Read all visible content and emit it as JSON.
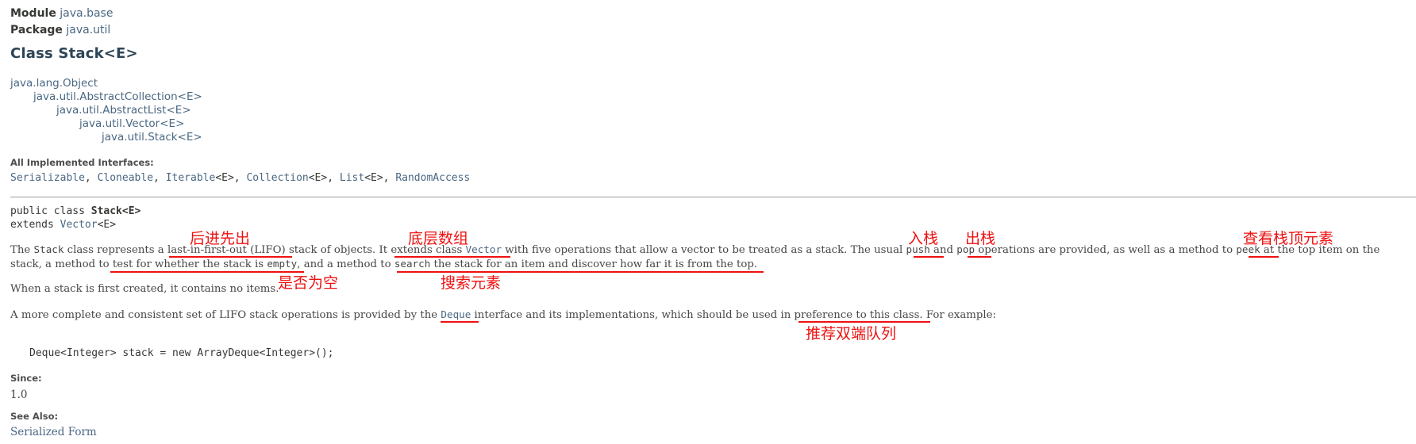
{
  "header": {
    "module_label": "Module",
    "module_value": "java.base",
    "package_label": "Package",
    "package_value": "java.util",
    "class_title": "Class Stack<E>"
  },
  "hierarchy": [
    "java.lang.Object",
    "java.util.AbstractCollection<E>",
    "java.util.AbstractList<E>",
    "java.util.Vector<E>",
    "java.util.Stack<E>"
  ],
  "interfaces": {
    "label": "All Implemented Interfaces:",
    "items": [
      "Serializable",
      "Cloneable",
      "Iterable",
      "Collection",
      "List",
      "RandomAccess"
    ],
    "generic": "<E>",
    "sep": ", "
  },
  "signature": {
    "line1_prefix": "public class ",
    "line1_name": "Stack<E>",
    "line2_prefix": "extends ",
    "line2_link": "Vector",
    "line2_suffix": "<E>"
  },
  "description": {
    "p1_l1": [
      {
        "text": "The ",
        "style": "t"
      },
      {
        "text": "Stack",
        "style": "code"
      },
      {
        "text": " class represents a ",
        "style": "t"
      },
      {
        "text": "last-in-first-out (LIFO)",
        "style": "t"
      },
      {
        "text": " stack of objects. It ",
        "style": "t"
      },
      {
        "text": "extends class ",
        "style": "t"
      },
      {
        "text": "Vector",
        "style": "codelnk"
      },
      {
        "text": " with five operations that allow a vector to be treated as a stack. The usual ",
        "style": "t"
      },
      {
        "text": "push",
        "style": "code"
      },
      {
        "text": " and ",
        "style": "t"
      },
      {
        "text": "pop",
        "style": "code"
      },
      {
        "text": " operations are provided, as well as a method to ",
        "style": "t"
      },
      {
        "text": "peek",
        "style": "code"
      },
      {
        "text": " at the top item on the",
        "style": "t"
      }
    ],
    "p1_l2": [
      {
        "text": "stack, a method to ",
        "style": "t"
      },
      {
        "text": "test for whether the stack is ",
        "style": "t"
      },
      {
        "text": "empty",
        "style": "code"
      },
      {
        "text": ", and a method to ",
        "style": "t"
      },
      {
        "text": "search",
        "style": "code"
      },
      {
        "text": " the stack for an item and discover how far it is from the top",
        "style": "t"
      },
      {
        "text": ".",
        "style": "t"
      }
    ],
    "p2": "When a stack is first created, it contains no items.",
    "p3": [
      {
        "text": "A more complete and consistent set of LIFO stack operations is provided by the ",
        "style": "t"
      },
      {
        "text": "Deque",
        "style": "codelnk"
      },
      {
        "text": " interface and its implementations, which should be used in ",
        "style": "t"
      },
      {
        "text": "preference to this class",
        "style": "t"
      },
      {
        "text": ". For example:",
        "style": "t"
      }
    ],
    "code_example": "Deque<Integer> stack = new ArrayDeque<Integer>();"
  },
  "since": {
    "label": "Since:",
    "value": "1.0"
  },
  "see_also": {
    "label": "See Also:",
    "value": "Serialized Form"
  },
  "annotations": {
    "lifo": "后进先出",
    "array": "底层数组",
    "push": "入栈",
    "pop": "出栈",
    "peek": "查看栈顶元素",
    "empty": "是否为空",
    "search": "搜索元素",
    "deque": "推荐双端队列",
    "color": "#ee1111"
  },
  "colors": {
    "link": "#4a6782",
    "title": "#2c4557",
    "text": "#474747",
    "annotation": "#ee1111"
  }
}
